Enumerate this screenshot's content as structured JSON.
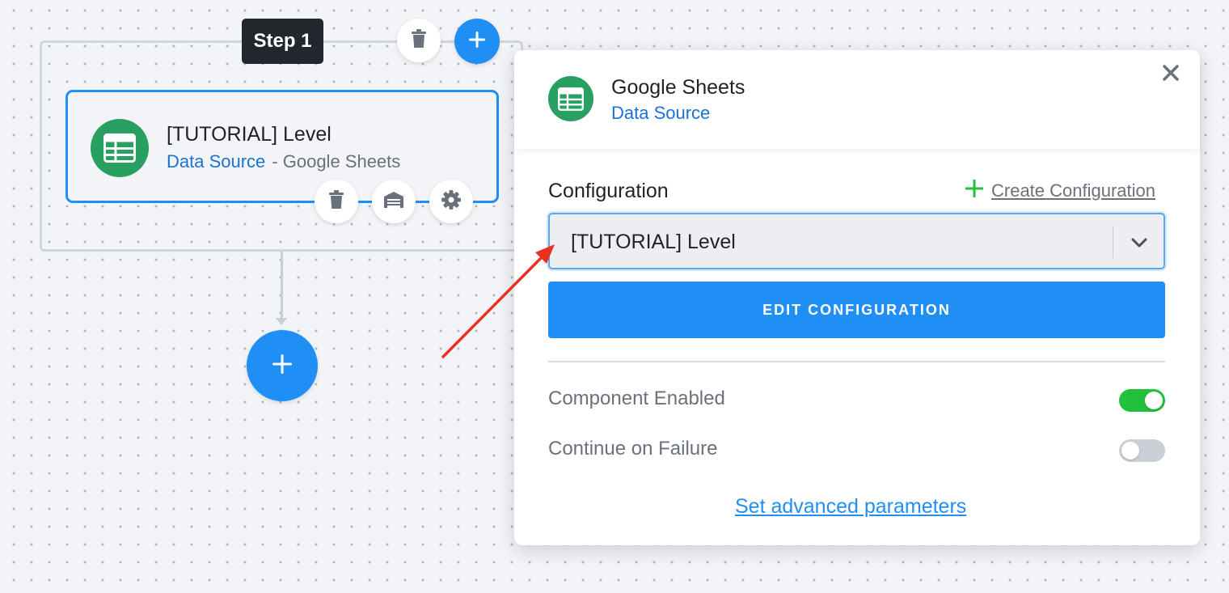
{
  "step": {
    "label": "Step 1",
    "delete_icon": "trash-icon",
    "add_icon": "plus-icon"
  },
  "component_card": {
    "title": "[TUTORIAL] Level",
    "type": "Data Source",
    "source": "- Google Sheets",
    "icon": "google-sheets-icon",
    "actions": [
      "trash-icon",
      "garage-icon",
      "gear-icon"
    ]
  },
  "add_step_icon": "plus-icon",
  "panel": {
    "title": "Google Sheets",
    "subtitle": "Data Source",
    "close_icon": "close-icon",
    "configuration_label": "Configuration",
    "create_configuration": "Create Configuration",
    "selected_configuration": "[TUTORIAL] Level",
    "edit_button": "EDIT CONFIGURATION",
    "options": [
      {
        "label": "Component Enabled",
        "enabled": true
      },
      {
        "label": "Continue on Failure",
        "enabled": false
      }
    ],
    "advanced_link": "Set advanced parameters"
  },
  "colors": {
    "accent": "#1f8ff5",
    "sheets_green": "#27a062",
    "toggle_on": "#22c03c",
    "annotation_arrow": "#e8321f"
  }
}
